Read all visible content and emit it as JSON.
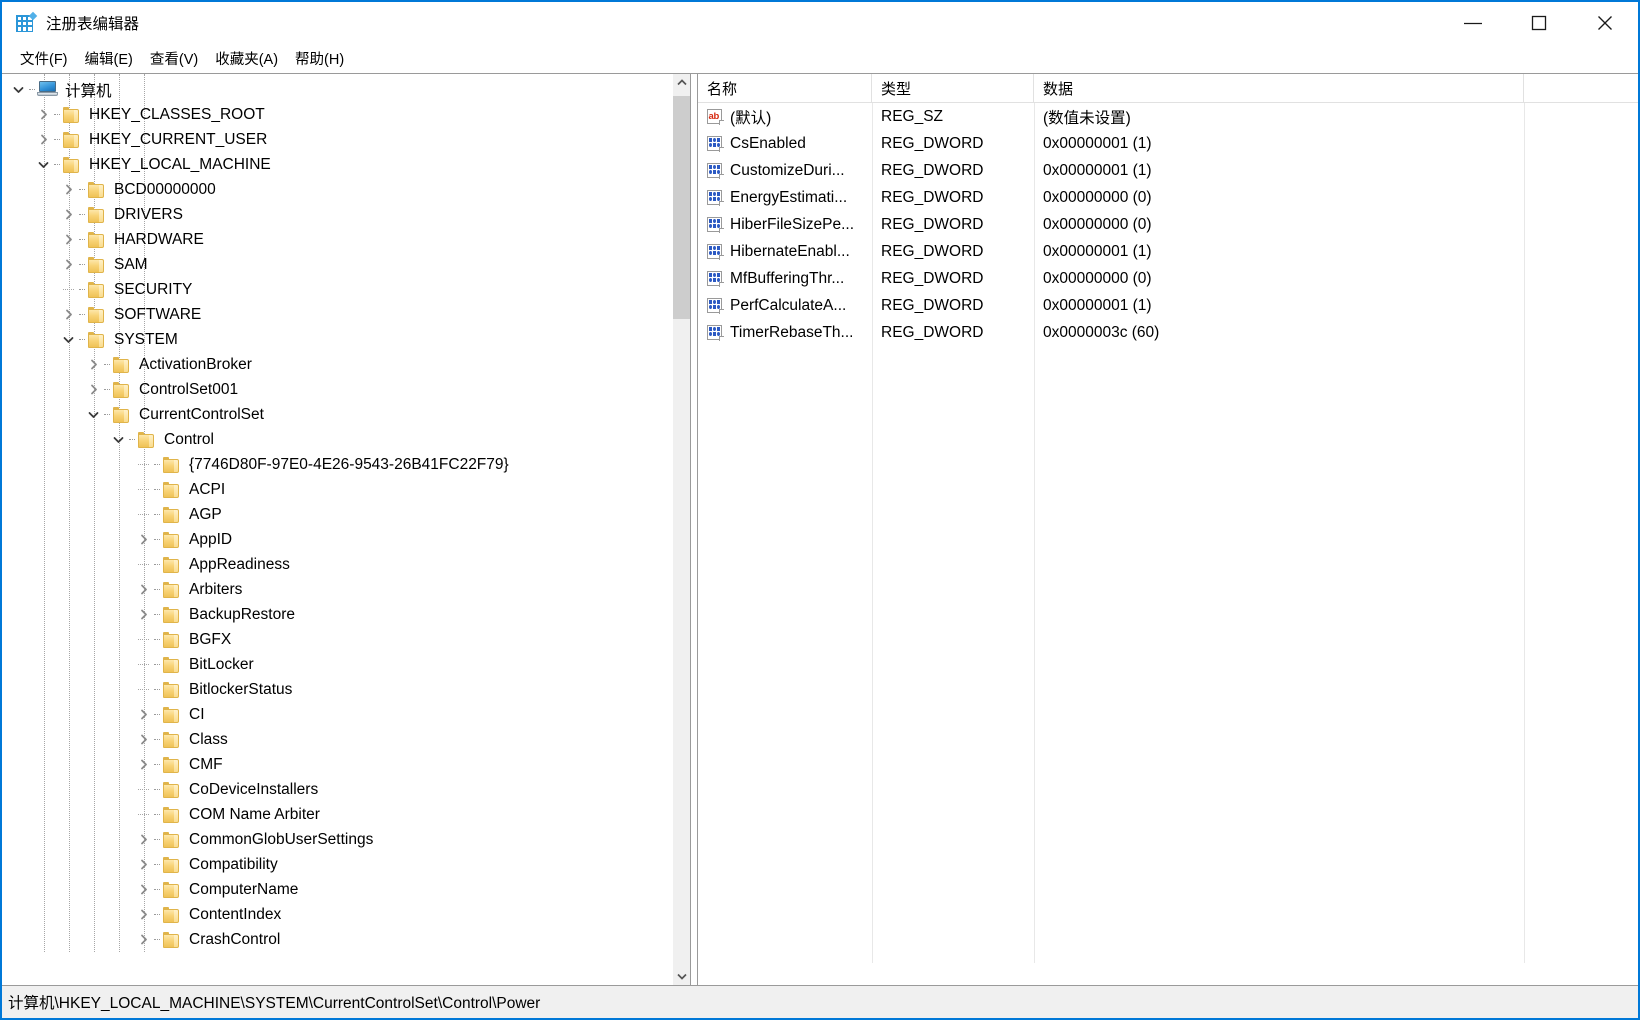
{
  "window": {
    "title": "注册表编辑器",
    "app_icon": "registry-editor-icon",
    "accent_color": "#0078d7",
    "controls": {
      "minimize": "最小化",
      "maximize": "最大化",
      "close": "关闭"
    }
  },
  "menubar": {
    "items": [
      {
        "label": "文件(F)"
      },
      {
        "label": "编辑(E)"
      },
      {
        "label": "查看(V)"
      },
      {
        "label": "收藏夹(A)"
      },
      {
        "label": "帮助(H)"
      }
    ]
  },
  "tree": {
    "nodes": [
      {
        "label": "计算机",
        "depth": 0,
        "state": "expanded",
        "icon": "computer-icon"
      },
      {
        "label": "HKEY_CLASSES_ROOT",
        "depth": 1,
        "state": "collapsed",
        "icon": "folder-icon"
      },
      {
        "label": "HKEY_CURRENT_USER",
        "depth": 1,
        "state": "collapsed",
        "icon": "folder-icon"
      },
      {
        "label": "HKEY_LOCAL_MACHINE",
        "depth": 1,
        "state": "expanded",
        "icon": "folder-icon"
      },
      {
        "label": "BCD00000000",
        "depth": 2,
        "state": "collapsed",
        "icon": "folder-icon"
      },
      {
        "label": "DRIVERS",
        "depth": 2,
        "state": "collapsed",
        "icon": "folder-icon"
      },
      {
        "label": "HARDWARE",
        "depth": 2,
        "state": "collapsed",
        "icon": "folder-icon"
      },
      {
        "label": "SAM",
        "depth": 2,
        "state": "collapsed",
        "icon": "folder-icon"
      },
      {
        "label": "SECURITY",
        "depth": 2,
        "state": "leaf",
        "icon": "folder-icon"
      },
      {
        "label": "SOFTWARE",
        "depth": 2,
        "state": "collapsed",
        "icon": "folder-icon"
      },
      {
        "label": "SYSTEM",
        "depth": 2,
        "state": "expanded",
        "icon": "folder-icon"
      },
      {
        "label": "ActivationBroker",
        "depth": 3,
        "state": "collapsed",
        "icon": "folder-icon"
      },
      {
        "label": "ControlSet001",
        "depth": 3,
        "state": "collapsed",
        "icon": "folder-icon"
      },
      {
        "label": "CurrentControlSet",
        "depth": 3,
        "state": "expanded",
        "icon": "folder-icon"
      },
      {
        "label": "Control",
        "depth": 4,
        "state": "expanded",
        "icon": "folder-icon"
      },
      {
        "label": "{7746D80F-97E0-4E26-9543-26B41FC22F79}",
        "depth": 5,
        "state": "leaf",
        "icon": "folder-icon"
      },
      {
        "label": "ACPI",
        "depth": 5,
        "state": "leaf",
        "icon": "folder-icon"
      },
      {
        "label": "AGP",
        "depth": 5,
        "state": "leaf",
        "icon": "folder-icon"
      },
      {
        "label": "AppID",
        "depth": 5,
        "state": "collapsed",
        "icon": "folder-icon"
      },
      {
        "label": "AppReadiness",
        "depth": 5,
        "state": "leaf",
        "icon": "folder-icon"
      },
      {
        "label": "Arbiters",
        "depth": 5,
        "state": "collapsed",
        "icon": "folder-icon"
      },
      {
        "label": "BackupRestore",
        "depth": 5,
        "state": "collapsed",
        "icon": "folder-icon"
      },
      {
        "label": "BGFX",
        "depth": 5,
        "state": "leaf",
        "icon": "folder-icon"
      },
      {
        "label": "BitLocker",
        "depth": 5,
        "state": "leaf",
        "icon": "folder-icon"
      },
      {
        "label": "BitlockerStatus",
        "depth": 5,
        "state": "leaf",
        "icon": "folder-icon"
      },
      {
        "label": "CI",
        "depth": 5,
        "state": "collapsed",
        "icon": "folder-icon"
      },
      {
        "label": "Class",
        "depth": 5,
        "state": "collapsed",
        "icon": "folder-icon"
      },
      {
        "label": "CMF",
        "depth": 5,
        "state": "collapsed",
        "icon": "folder-icon"
      },
      {
        "label": "CoDeviceInstallers",
        "depth": 5,
        "state": "leaf",
        "icon": "folder-icon"
      },
      {
        "label": "COM Name Arbiter",
        "depth": 5,
        "state": "leaf",
        "icon": "folder-icon"
      },
      {
        "label": "CommonGlobUserSettings",
        "depth": 5,
        "state": "collapsed",
        "icon": "folder-icon"
      },
      {
        "label": "Compatibility",
        "depth": 5,
        "state": "collapsed",
        "icon": "folder-icon"
      },
      {
        "label": "ComputerName",
        "depth": 5,
        "state": "collapsed",
        "icon": "folder-icon"
      },
      {
        "label": "ContentIndex",
        "depth": 5,
        "state": "collapsed",
        "icon": "folder-icon"
      },
      {
        "label": "CrashControl",
        "depth": 5,
        "state": "collapsed",
        "icon": "folder-icon"
      }
    ],
    "scrollbar": {
      "up_arrow": "向上滚动",
      "down_arrow": "向下滚动"
    }
  },
  "values": {
    "columns": [
      {
        "label": "名称"
      },
      {
        "label": "类型"
      },
      {
        "label": "数据"
      }
    ],
    "rows": [
      {
        "name": "(默认)",
        "type": "REG_SZ",
        "data": "(数值未设置)",
        "icon": "string-value-icon"
      },
      {
        "name": "CsEnabled",
        "type": "REG_DWORD",
        "data": "0x00000001 (1)",
        "icon": "dword-value-icon"
      },
      {
        "name": "CustomizeDuri...",
        "type": "REG_DWORD",
        "data": "0x00000001 (1)",
        "icon": "dword-value-icon"
      },
      {
        "name": "EnergyEstimati...",
        "type": "REG_DWORD",
        "data": "0x00000000 (0)",
        "icon": "dword-value-icon"
      },
      {
        "name": "HiberFileSizePe...",
        "type": "REG_DWORD",
        "data": "0x00000000 (0)",
        "icon": "dword-value-icon"
      },
      {
        "name": "HibernateEnabl...",
        "type": "REG_DWORD",
        "data": "0x00000001 (1)",
        "icon": "dword-value-icon"
      },
      {
        "name": "MfBufferingThr...",
        "type": "REG_DWORD",
        "data": "0x00000000 (0)",
        "icon": "dword-value-icon"
      },
      {
        "name": "PerfCalculateA...",
        "type": "REG_DWORD",
        "data": "0x00000001 (1)",
        "icon": "dword-value-icon"
      },
      {
        "name": "TimerRebaseTh...",
        "type": "REG_DWORD",
        "data": "0x0000003c (60)",
        "icon": "dword-value-icon"
      }
    ]
  },
  "statusbar": {
    "path": "计算机\\HKEY_LOCAL_MACHINE\\SYSTEM\\CurrentControlSet\\Control\\Power"
  }
}
